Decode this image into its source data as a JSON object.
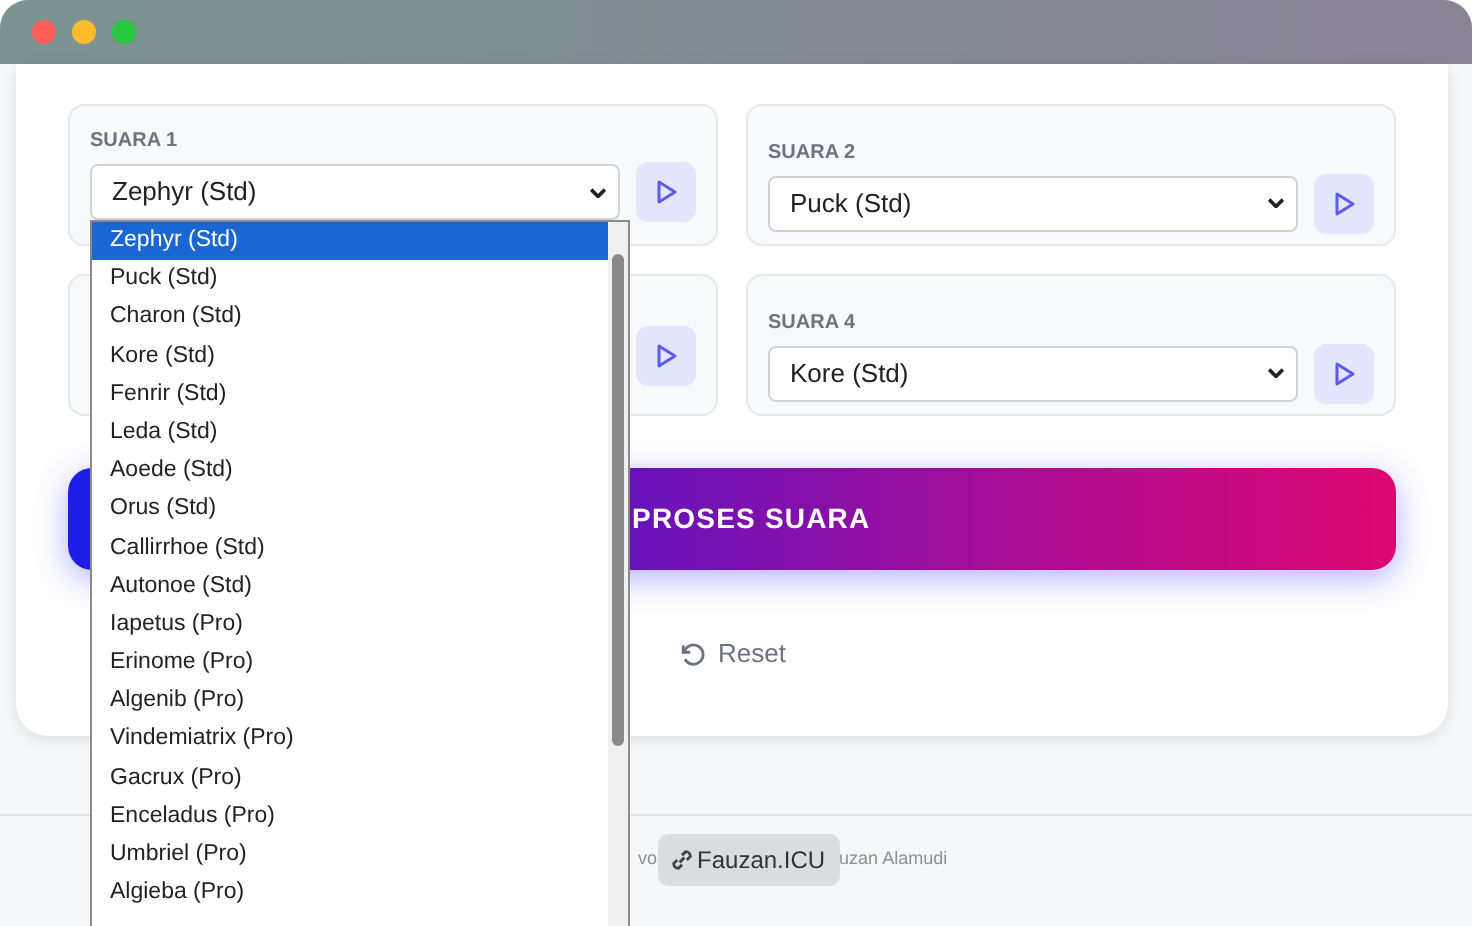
{
  "window": {
    "controls": [
      {
        "color": "#ff5f57"
      },
      {
        "color": "#febc2e"
      },
      {
        "color": "#28c840"
      }
    ]
  },
  "voices": [
    {
      "kind": "select",
      "label": "SUARA 1",
      "value": "Zephyr (Std)"
    },
    {
      "kind": "select",
      "label": "SUARA 2",
      "value": "Puck (Std)"
    },
    {
      "kind": "covered"
    },
    {
      "kind": "select",
      "label": "SUARA 4",
      "value": "Kore (Std)"
    }
  ],
  "dropdown": {
    "options": [
      {
        "label": "Zephyr (Std)",
        "selected": true
      },
      {
        "label": "Puck (Std)",
        "selected": false
      },
      {
        "label": "Charon (Std)",
        "selected": false
      },
      {
        "label": "Kore (Std)",
        "selected": false
      },
      {
        "label": "Fenrir (Std)",
        "selected": false
      },
      {
        "label": "Leda (Std)",
        "selected": false
      },
      {
        "label": "Aoede (Std)",
        "selected": false
      },
      {
        "label": "Orus (Std)",
        "selected": false
      },
      {
        "label": "Callirrhoe (Std)",
        "selected": false
      },
      {
        "label": "Autonoe (Std)",
        "selected": false
      },
      {
        "label": "Iapetus (Pro)",
        "selected": false
      },
      {
        "label": "Erinome (Pro)",
        "selected": false
      },
      {
        "label": "Algenib (Pro)",
        "selected": false
      },
      {
        "label": "Vindemiatrix (Pro)",
        "selected": false
      },
      {
        "label": "Gacrux (Pro)",
        "selected": false
      },
      {
        "label": "Enceladus (Pro)",
        "selected": false
      },
      {
        "label": "Umbriel (Pro)",
        "selected": false
      },
      {
        "label": "Algieba (Pro)",
        "selected": false
      }
    ]
  },
  "process_button": "PROSES SUARA",
  "reset_button": "Reset",
  "footer": {
    "text_left": "vo",
    "badge": "Fauzan.ICU",
    "text_right": "uzan Alamudi"
  }
}
